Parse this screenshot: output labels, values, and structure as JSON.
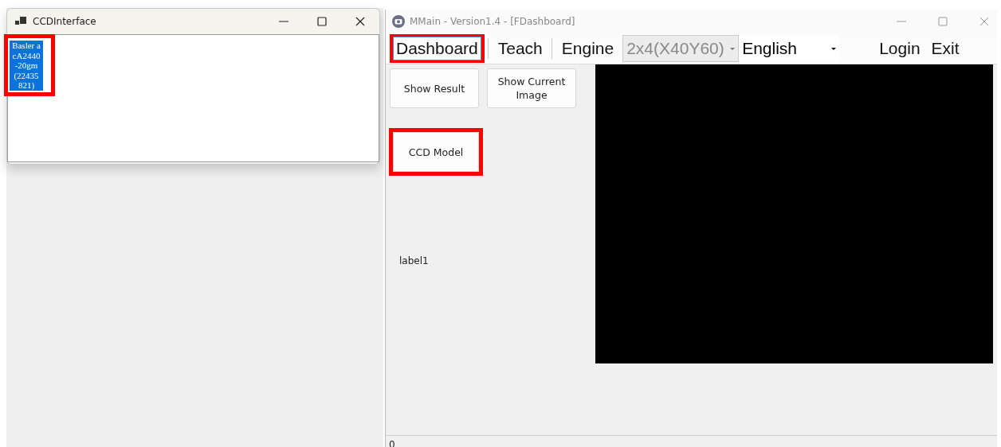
{
  "ccd_window": {
    "title": "CCDInterface",
    "devices": [
      {
        "label": "Basler acA2440-20gm (22435821)",
        "selected": true,
        "highlighted": true
      }
    ]
  },
  "main_window": {
    "title": "MMain - Version1.4 - [FDashboard]",
    "menu": [
      {
        "kind": "tab",
        "label": "Dashboard",
        "selected": true,
        "highlighted": true
      },
      {
        "kind": "tab",
        "label": "Teach",
        "selected": false,
        "highlighted": false
      },
      {
        "kind": "tab",
        "label": "Engine",
        "selected": false,
        "highlighted": false
      },
      {
        "kind": "combo",
        "value": "2x4(X40Y60)",
        "disabled": true
      },
      {
        "kind": "combo",
        "value": "English",
        "disabled": false
      },
      {
        "kind": "link",
        "label": "Login"
      },
      {
        "kind": "link",
        "label": "Exit"
      }
    ],
    "button_rows": [
      [
        {
          "label": "Show Result",
          "highlighted": false
        },
        {
          "label": "Show Current Image",
          "highlighted": false
        }
      ],
      [
        {
          "label": "CCD Model",
          "highlighted": true
        }
      ]
    ],
    "label": "label1",
    "status": "0"
  }
}
